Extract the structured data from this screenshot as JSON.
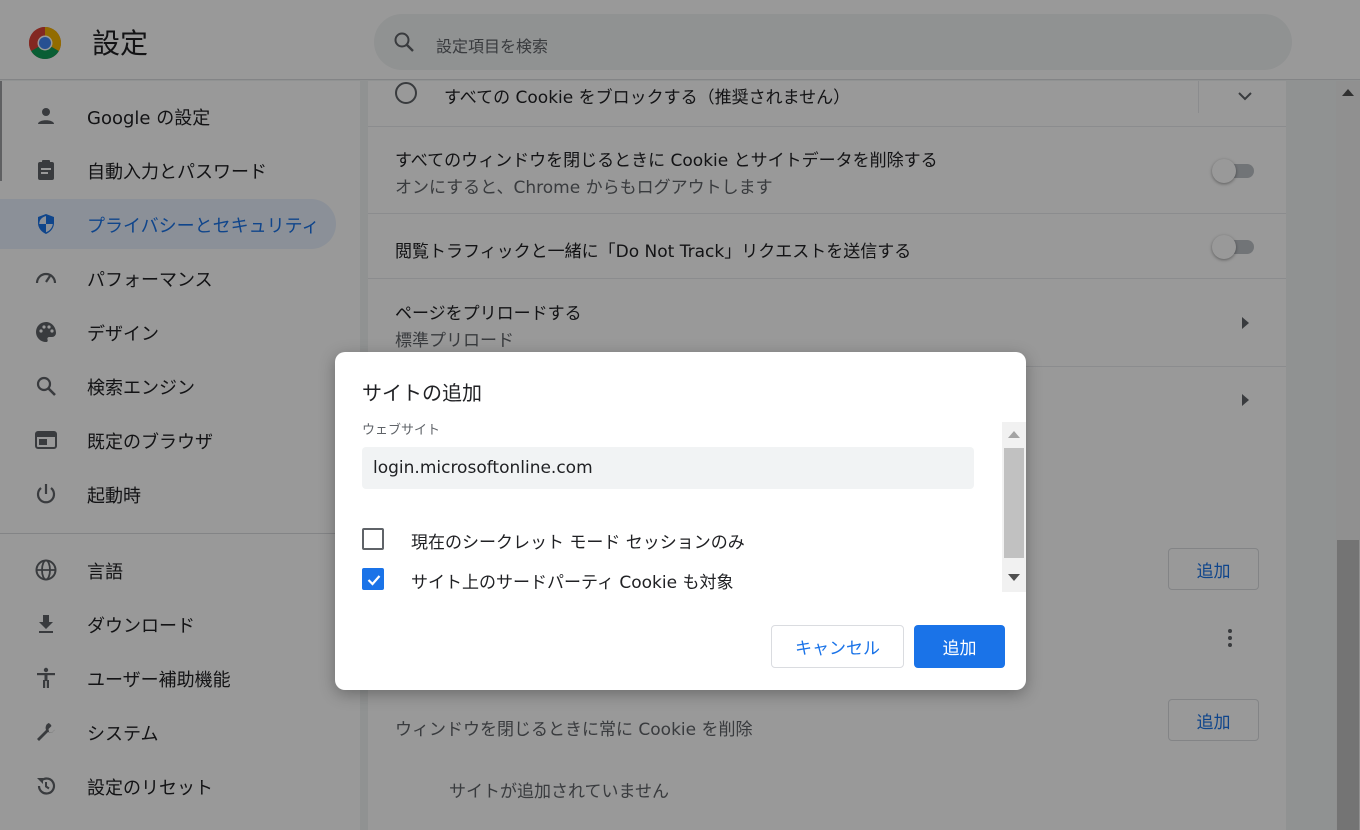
{
  "header": {
    "title": "設定",
    "search_placeholder": "設定項目を検索"
  },
  "sidebar": {
    "items": [
      {
        "label": "Google の設定",
        "icon": "person-icon"
      },
      {
        "label": "自動入力とパスワード",
        "icon": "clipboard-icon"
      },
      {
        "label": "プライバシーとセキュリティ",
        "icon": "shield-icon",
        "active": true
      },
      {
        "label": "パフォーマンス",
        "icon": "speedometer-icon"
      },
      {
        "label": "デザイン",
        "icon": "palette-icon"
      },
      {
        "label": "検索エンジン",
        "icon": "search-icon"
      },
      {
        "label": "既定のブラウザ",
        "icon": "browser-icon"
      },
      {
        "label": "起動時",
        "icon": "power-icon"
      },
      {
        "label": "言語",
        "icon": "globe-icon"
      },
      {
        "label": "ダウンロード",
        "icon": "download-icon"
      },
      {
        "label": "ユーザー補助機能",
        "icon": "accessibility-icon"
      },
      {
        "label": "システム",
        "icon": "wrench-icon"
      },
      {
        "label": "設定のリセット",
        "icon": "reset-icon"
      }
    ]
  },
  "content": {
    "block_all_cookies": "すべての Cookie をブロックする（推奨されません）",
    "clear_on_close_title": "すべてのウィンドウを閉じるときに Cookie とサイトデータを削除する",
    "clear_on_close_sub": "オンにすると、Chrome からもログアウトします",
    "do_not_track": "閲覧トラフィックと一緒に「Do Not Track」リクエストを送信する",
    "preload_title": "ページをプリロードする",
    "preload_sub": "標準プリロード",
    "add_label": "追加",
    "always_clear_title": "ウィンドウを閉じるときに常に Cookie を削除",
    "no_sites": "サイトが追加されていません"
  },
  "dialog": {
    "title": "サイトの追加",
    "field_label": "ウェブサイト",
    "site_value": "login.microsoftonline.com",
    "incognito_only": "現在のシークレット モード セッションのみ",
    "incognito_checked": false,
    "third_party": "サイト上のサードパーティ Cookie も対象",
    "third_party_checked": true,
    "cancel": "キャンセル",
    "add": "追加"
  },
  "colors": {
    "accent": "#1a73e8",
    "active_bg": "#e8f0fe"
  }
}
